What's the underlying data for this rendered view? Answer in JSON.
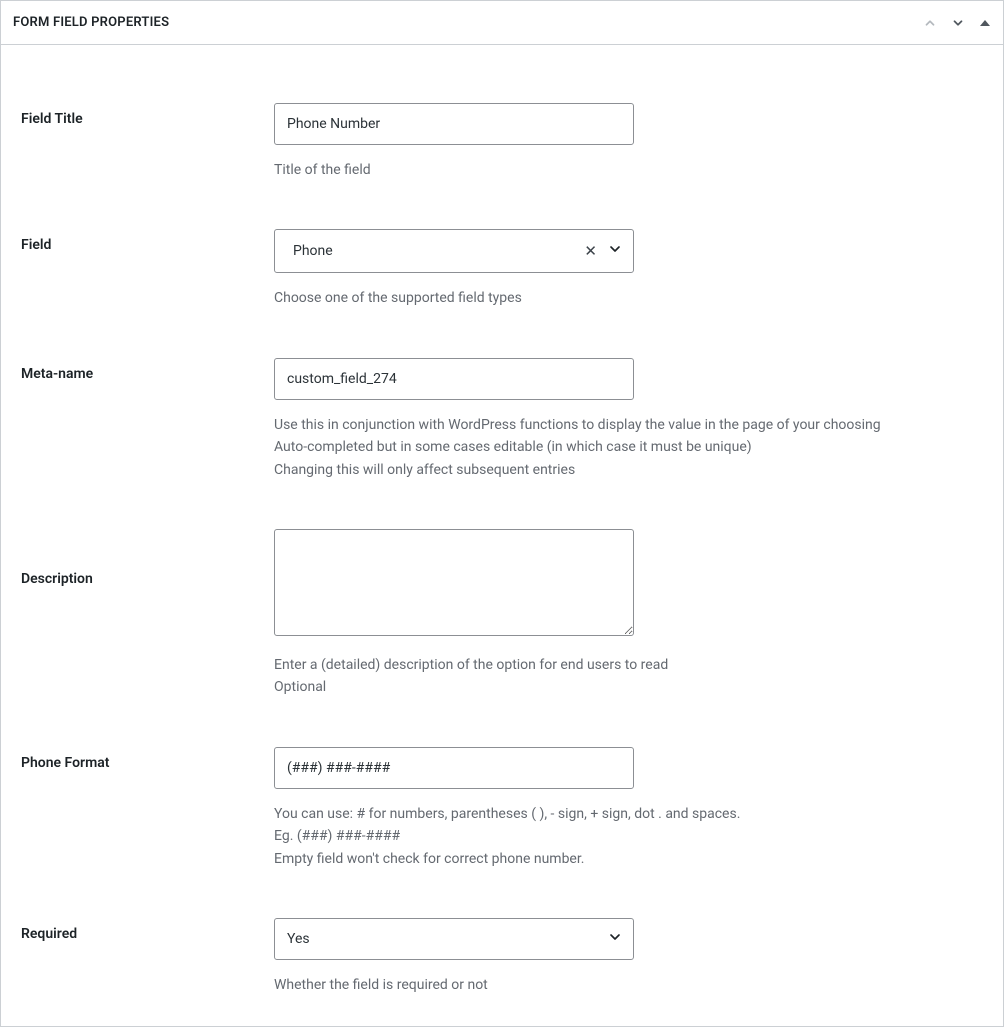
{
  "header": {
    "title": "FORM FIELD PROPERTIES"
  },
  "fields": {
    "title": {
      "label": "Field Title",
      "value": "Phone Number",
      "help": "Title of the field"
    },
    "field_type": {
      "label": "Field",
      "selected": "Phone",
      "help": "Choose one of the supported field types"
    },
    "meta_name": {
      "label": "Meta-name",
      "value": "custom_field_274",
      "help_line1": "Use this in conjunction with WordPress functions to display the value in the page of your choosing",
      "help_line2": "Auto-completed but in some cases editable (in which case it must be unique)",
      "help_line3": "Changing this will only affect subsequent entries"
    },
    "description": {
      "label": "Description",
      "value": "",
      "help_line1": "Enter a (detailed) description of the option for end users to read",
      "help_line2": "Optional"
    },
    "phone_format": {
      "label": "Phone Format",
      "value": "(###) ###-####",
      "help_line1": "You can use: # for numbers, parentheses ( ), - sign, + sign, dot . and spaces.",
      "help_line2": "Eg. (###) ###-####",
      "help_line3": "Empty field won't check for correct phone number."
    },
    "required": {
      "label": "Required",
      "selected": "Yes",
      "help": "Whether the field is required or not"
    }
  }
}
